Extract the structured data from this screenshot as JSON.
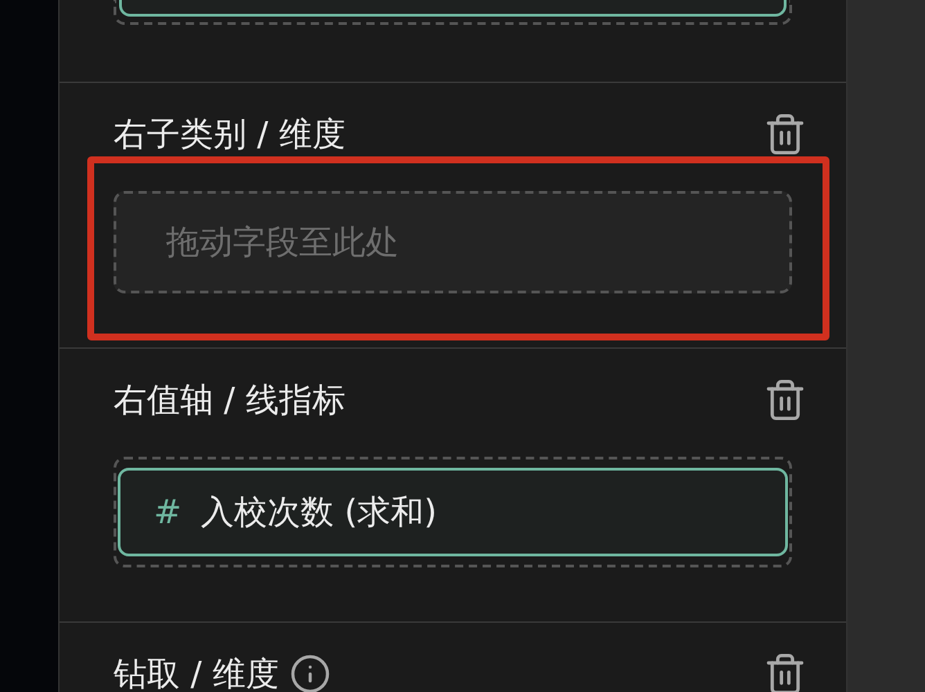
{
  "sections": [
    {
      "title": "右子类别 / 维度",
      "placeholder": "拖动字段至此处",
      "highlighted": true
    },
    {
      "title": "右值轴 / 线指标",
      "highlighted": false,
      "fields": [
        {
          "type_mark": "#",
          "label": "入校次数 (求和)"
        }
      ]
    },
    {
      "title": "钻取 / 维度",
      "info": true,
      "highlighted": false
    }
  ]
}
